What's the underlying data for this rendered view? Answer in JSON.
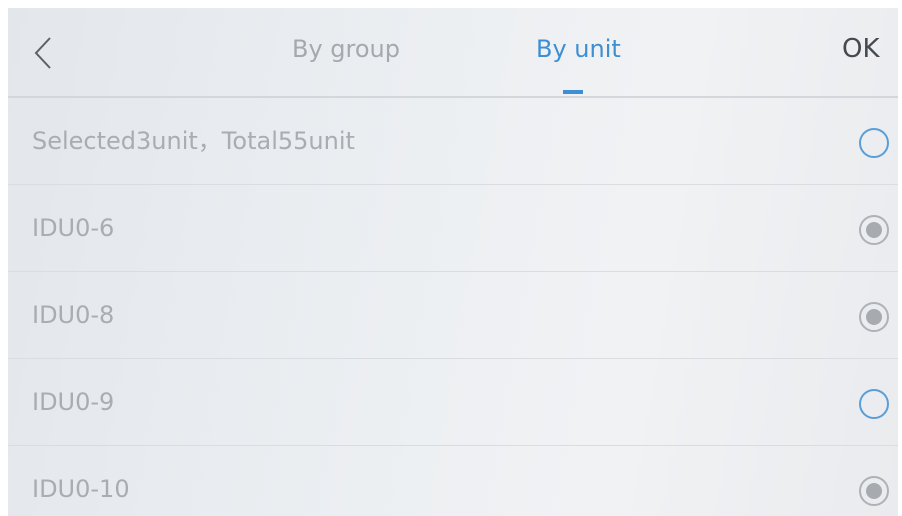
{
  "header": {
    "back_icon": "chevron-left-icon",
    "tabs": [
      {
        "label": "By group",
        "active": false
      },
      {
        "label": "By unit",
        "active": true
      }
    ],
    "ok_label": "OK"
  },
  "summary": {
    "text": "Selected3unit，Total55unit",
    "selected": false
  },
  "units": [
    {
      "label": "IDU0-6",
      "selected": true
    },
    {
      "label": "IDU0-8",
      "selected": true
    },
    {
      "label": "IDU0-9",
      "selected": false
    },
    {
      "label": "IDU0-10",
      "selected": true
    }
  ],
  "colors": {
    "accent": "#3e8ed3",
    "radio_empty": "#5a9ed8",
    "radio_checked": "#a7abaf",
    "text_muted": "#a8adb2"
  }
}
